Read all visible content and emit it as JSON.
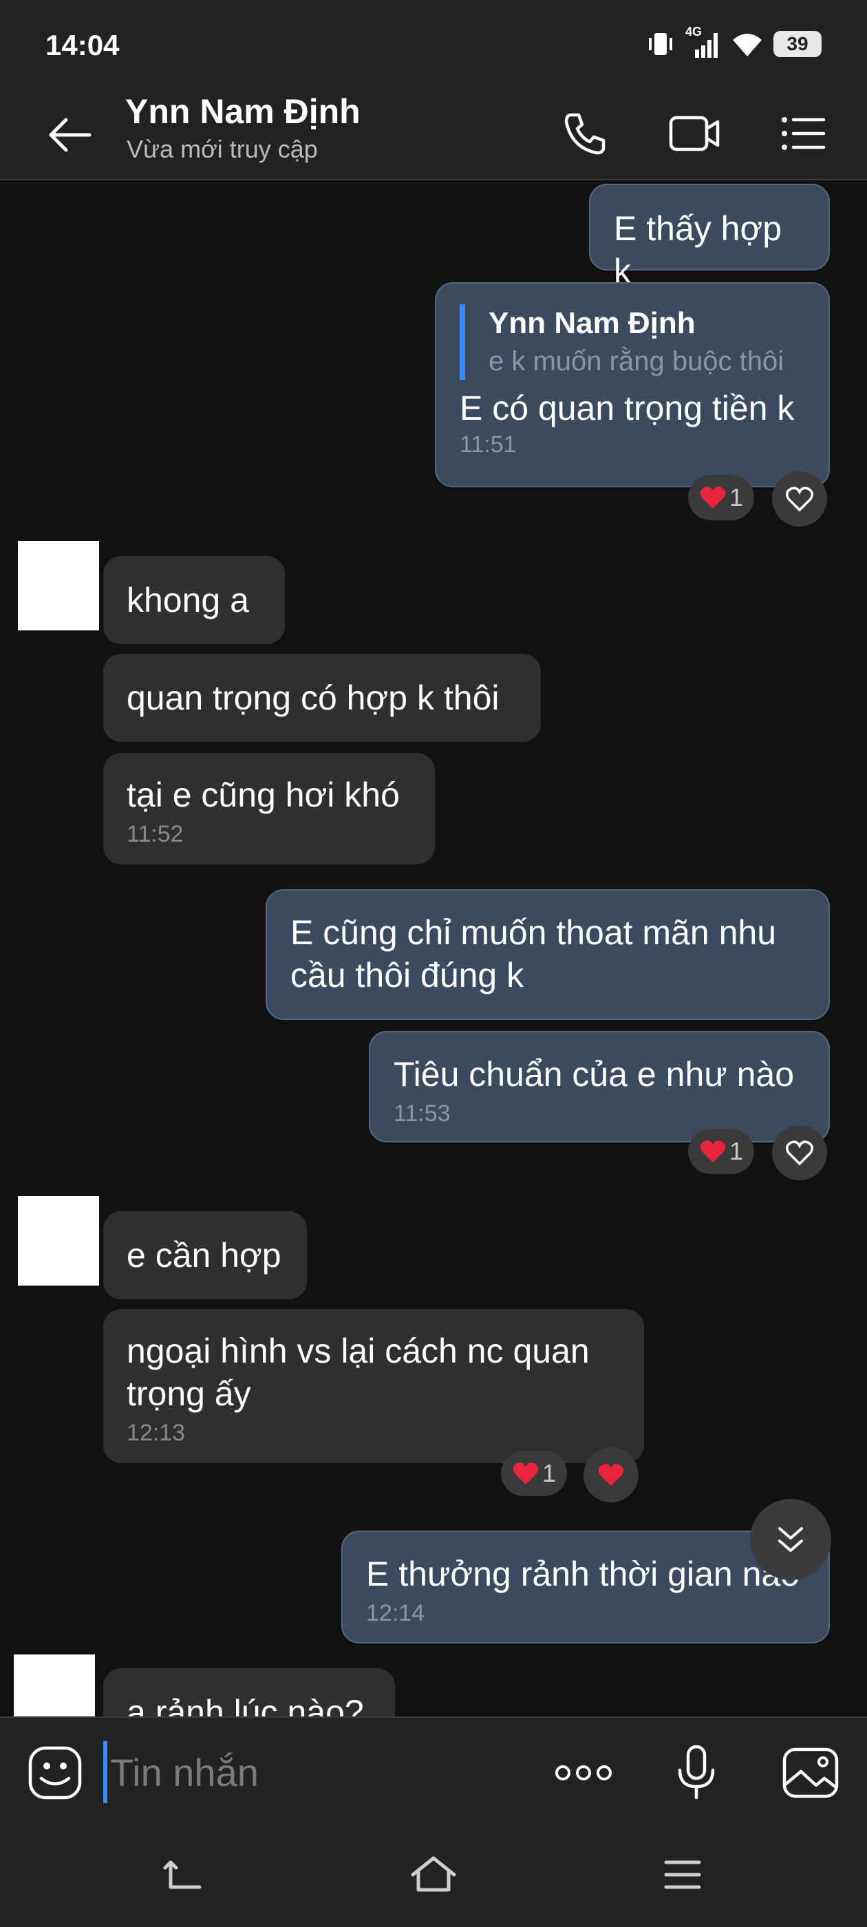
{
  "status_bar": {
    "time": "14:04",
    "network": "4G",
    "battery": "39"
  },
  "header": {
    "contact_name": "Ynn Nam Định",
    "contact_status": "Vừa mới truy cập"
  },
  "messages": [
    {
      "dir": "out",
      "text": "E thấy hợp k"
    },
    {
      "dir": "out",
      "quote_name": "Ynn Nam Định",
      "quote_text": "e k muốn rằng buộc thôi",
      "text": "E có quan trọng tiền k",
      "time": "11:51",
      "reaction_count": "1"
    },
    {
      "dir": "in",
      "text": "khong a"
    },
    {
      "dir": "in",
      "text": "quan trọng có hợp k thôi"
    },
    {
      "dir": "in",
      "text": "tại e cũng hơi khó",
      "time": "11:52"
    },
    {
      "dir": "out",
      "text": "E cũng chỉ muốn thoat mãn nhu cầu thôi đúng k"
    },
    {
      "dir": "out",
      "text": "Tiêu chuẩn của e như nào",
      "time": "11:53",
      "reaction_count": "1"
    },
    {
      "dir": "in",
      "text": "e cần hợp"
    },
    {
      "dir": "in",
      "text": "ngoại hình vs lại cách nc quan trọng ấy",
      "time": "12:13",
      "reaction_count": "1"
    },
    {
      "dir": "out",
      "text": "E thưởng rảnh thời gian nào",
      "time": "12:14"
    },
    {
      "dir": "in",
      "text": "a rảnh lúc nào?"
    }
  ],
  "input": {
    "placeholder": "Tin nhắn"
  },
  "colors": {
    "accent": "#3d8af7",
    "outgoing_bubble": "#3c4a5f",
    "incoming_bubble": "#2f2f31",
    "heart": "#e8253c"
  },
  "icons": [
    "back-arrow-icon",
    "phone-icon",
    "video-call-icon",
    "menu-list-icon",
    "heart-icon",
    "heart-outline-icon",
    "scroll-down-icon",
    "sticker-icon",
    "more-icon",
    "microphone-icon",
    "image-icon",
    "nav-back-icon",
    "nav-home-icon",
    "nav-menu-icon"
  ]
}
